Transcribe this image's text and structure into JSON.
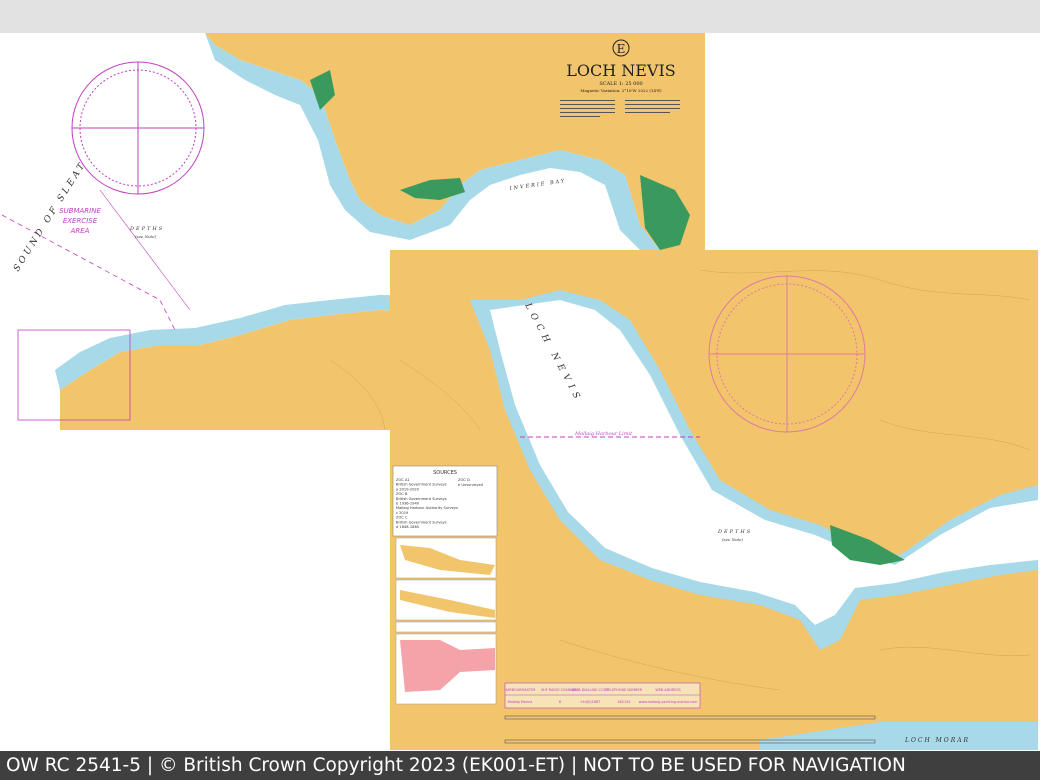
{
  "chart": {
    "letter": "E",
    "title": "LOCH NEVIS",
    "scale": "SCALE 1: 25 000",
    "magnetic": "Magnetic Variation: 2°10'W 2022 (14'E)"
  },
  "place_names": {
    "sound_of_sleat": "SOUND OF SLEAT",
    "submarine_area": [
      "SUBMARINE",
      "EXERCISE",
      "AREA"
    ],
    "loch_nevis": "LOCH NEVIS",
    "inverie_bay": "INVERIE BAY",
    "loch_morar": "LOCH MORAR",
    "mallaig_limit": "Mallaig Harbour Limit",
    "depths_note": "DEPTHS",
    "see_note": "(see Note)"
  },
  "sources_panel": {
    "title": "SOURCES",
    "lines": [
      "ZOC A1",
      "British Government Surveys",
      "a 2019-2020",
      "ZOC B",
      "British Government Surveys",
      "b 1936-1940",
      "Mallaig Harbour Authority Surveys",
      "c 2019",
      "ZOC C",
      "British Government Surveys",
      "d 1848-1860",
      "ZOC D",
      "e Unsurveyed"
    ]
  },
  "harbour_table": {
    "headers": [
      "HARBOURMASTER",
      "VHF RADIO CHANNELS",
      "AREA DIALLING CODE",
      "TELEPHONE NUMBER",
      "WEB ADDRESS"
    ],
    "row": [
      "Mallaig Marina",
      "8",
      "+44(0)1687",
      "462154",
      "www.mallaig-yachting-marina.com"
    ]
  },
  "footer": {
    "text": "OW RC 2541-5 | © British Crown Copyright 2023 (EK001-ET) | NOT TO BE USED FOR NAVIGATION"
  },
  "colors": {
    "land": "#f2c56c",
    "shallow": "#a7d9e8",
    "deep": "#ffffff",
    "drying": "#3a9a5e",
    "magenta": "#c040c0",
    "footer_bg": "#3f3f3f"
  }
}
